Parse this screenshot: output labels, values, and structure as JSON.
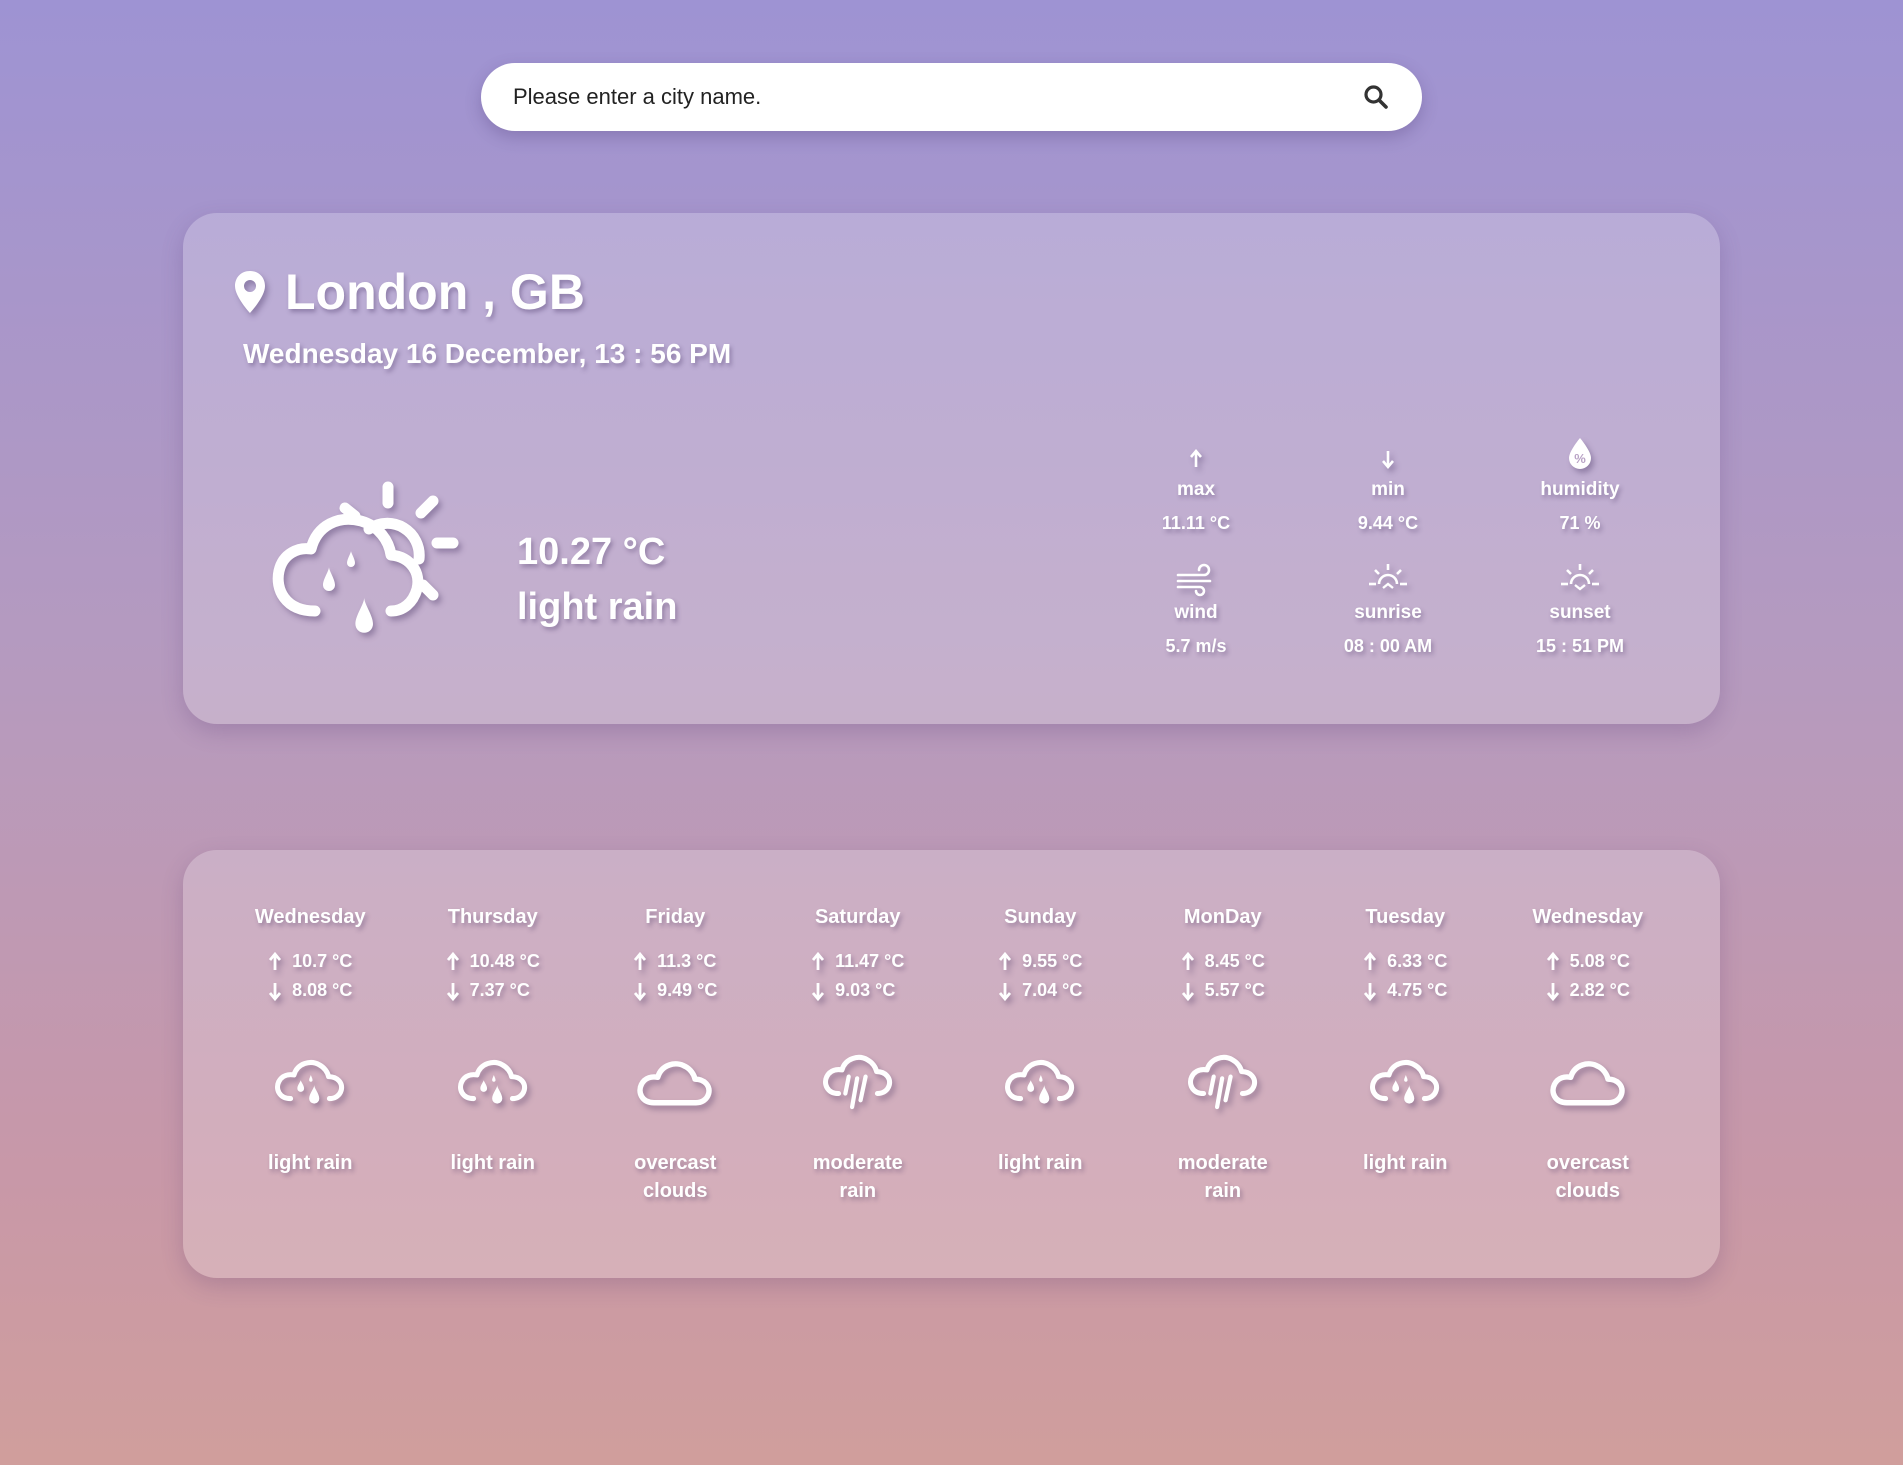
{
  "search": {
    "placeholder": "Please enter a city name.",
    "icon": "search-icon"
  },
  "current": {
    "city": "London , GB",
    "datetime": "Wednesday 16 December, 13 : 56 PM",
    "temperature": "10.27 °C",
    "description": "light rain",
    "icon": "partly-cloudy-rain-icon",
    "stats": [
      {
        "icon": "arrow-up-icon",
        "label": "max",
        "value": "11.11 °C"
      },
      {
        "icon": "arrow-down-icon",
        "label": "min",
        "value": "9.44 °C"
      },
      {
        "icon": "humidity-icon",
        "label": "humidity",
        "value": "71 %"
      },
      {
        "icon": "wind-icon",
        "label": "wind",
        "value": "5.7 m/s"
      },
      {
        "icon": "sunrise-icon",
        "label": "sunrise",
        "value": "08 : 00 AM"
      },
      {
        "icon": "sunset-icon",
        "label": "sunset",
        "value": "15 : 51 PM"
      }
    ]
  },
  "forecast": [
    {
      "day": "Wednesday",
      "max": "10.7 °C",
      "min": "8.08 °C",
      "icon": "cloud-rain-drops-icon",
      "desc": "light rain"
    },
    {
      "day": "Thursday",
      "max": "10.48 °C",
      "min": "7.37 °C",
      "icon": "cloud-rain-drops-icon",
      "desc": "light rain"
    },
    {
      "day": "Friday",
      "max": "11.3 °C",
      "min": "9.49 °C",
      "icon": "cloud-icon",
      "desc": "overcast clouds"
    },
    {
      "day": "Saturday",
      "max": "11.47 °C",
      "min": "9.03 °C",
      "icon": "cloud-showers-icon",
      "desc": "moderate rain"
    },
    {
      "day": "Sunday",
      "max": "9.55 °C",
      "min": "7.04 °C",
      "icon": "cloud-rain-drops-icon",
      "desc": "light rain"
    },
    {
      "day": "MonDay",
      "max": "8.45 °C",
      "min": "5.57 °C",
      "icon": "cloud-showers-icon",
      "desc": "moderate rain"
    },
    {
      "day": "Tuesday",
      "max": "6.33 °C",
      "min": "4.75 °C",
      "icon": "cloud-rain-drops-icon",
      "desc": "light rain"
    },
    {
      "day": "Wednesday",
      "max": "5.08 °C",
      "min": "2.82 °C",
      "icon": "cloud-icon",
      "desc": "overcast clouds"
    }
  ],
  "colors": {
    "bg_top": "#9e93d3",
    "bg_bottom": "#d09e9c",
    "card": "rgba(255,255,255,0.22)",
    "text": "#ffffff"
  }
}
